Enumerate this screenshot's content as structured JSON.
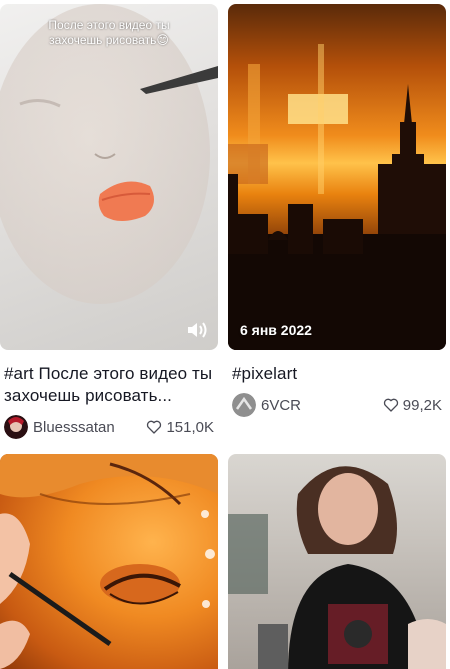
{
  "cards": [
    {
      "overlay_text": "После этого видео ты захочешь рисовать😊",
      "caption": "#art После этого видео ты захочешь рисовать...",
      "author": "Bluesssatan",
      "likes": "151,0K"
    },
    {
      "date": "6 янв 2022",
      "caption": "#pixelart",
      "author": "6VCR",
      "likes": "99,2K"
    },
    {},
    {}
  ],
  "icons": {
    "sound": "sound-on-icon",
    "heart": "heart-outline-icon"
  }
}
